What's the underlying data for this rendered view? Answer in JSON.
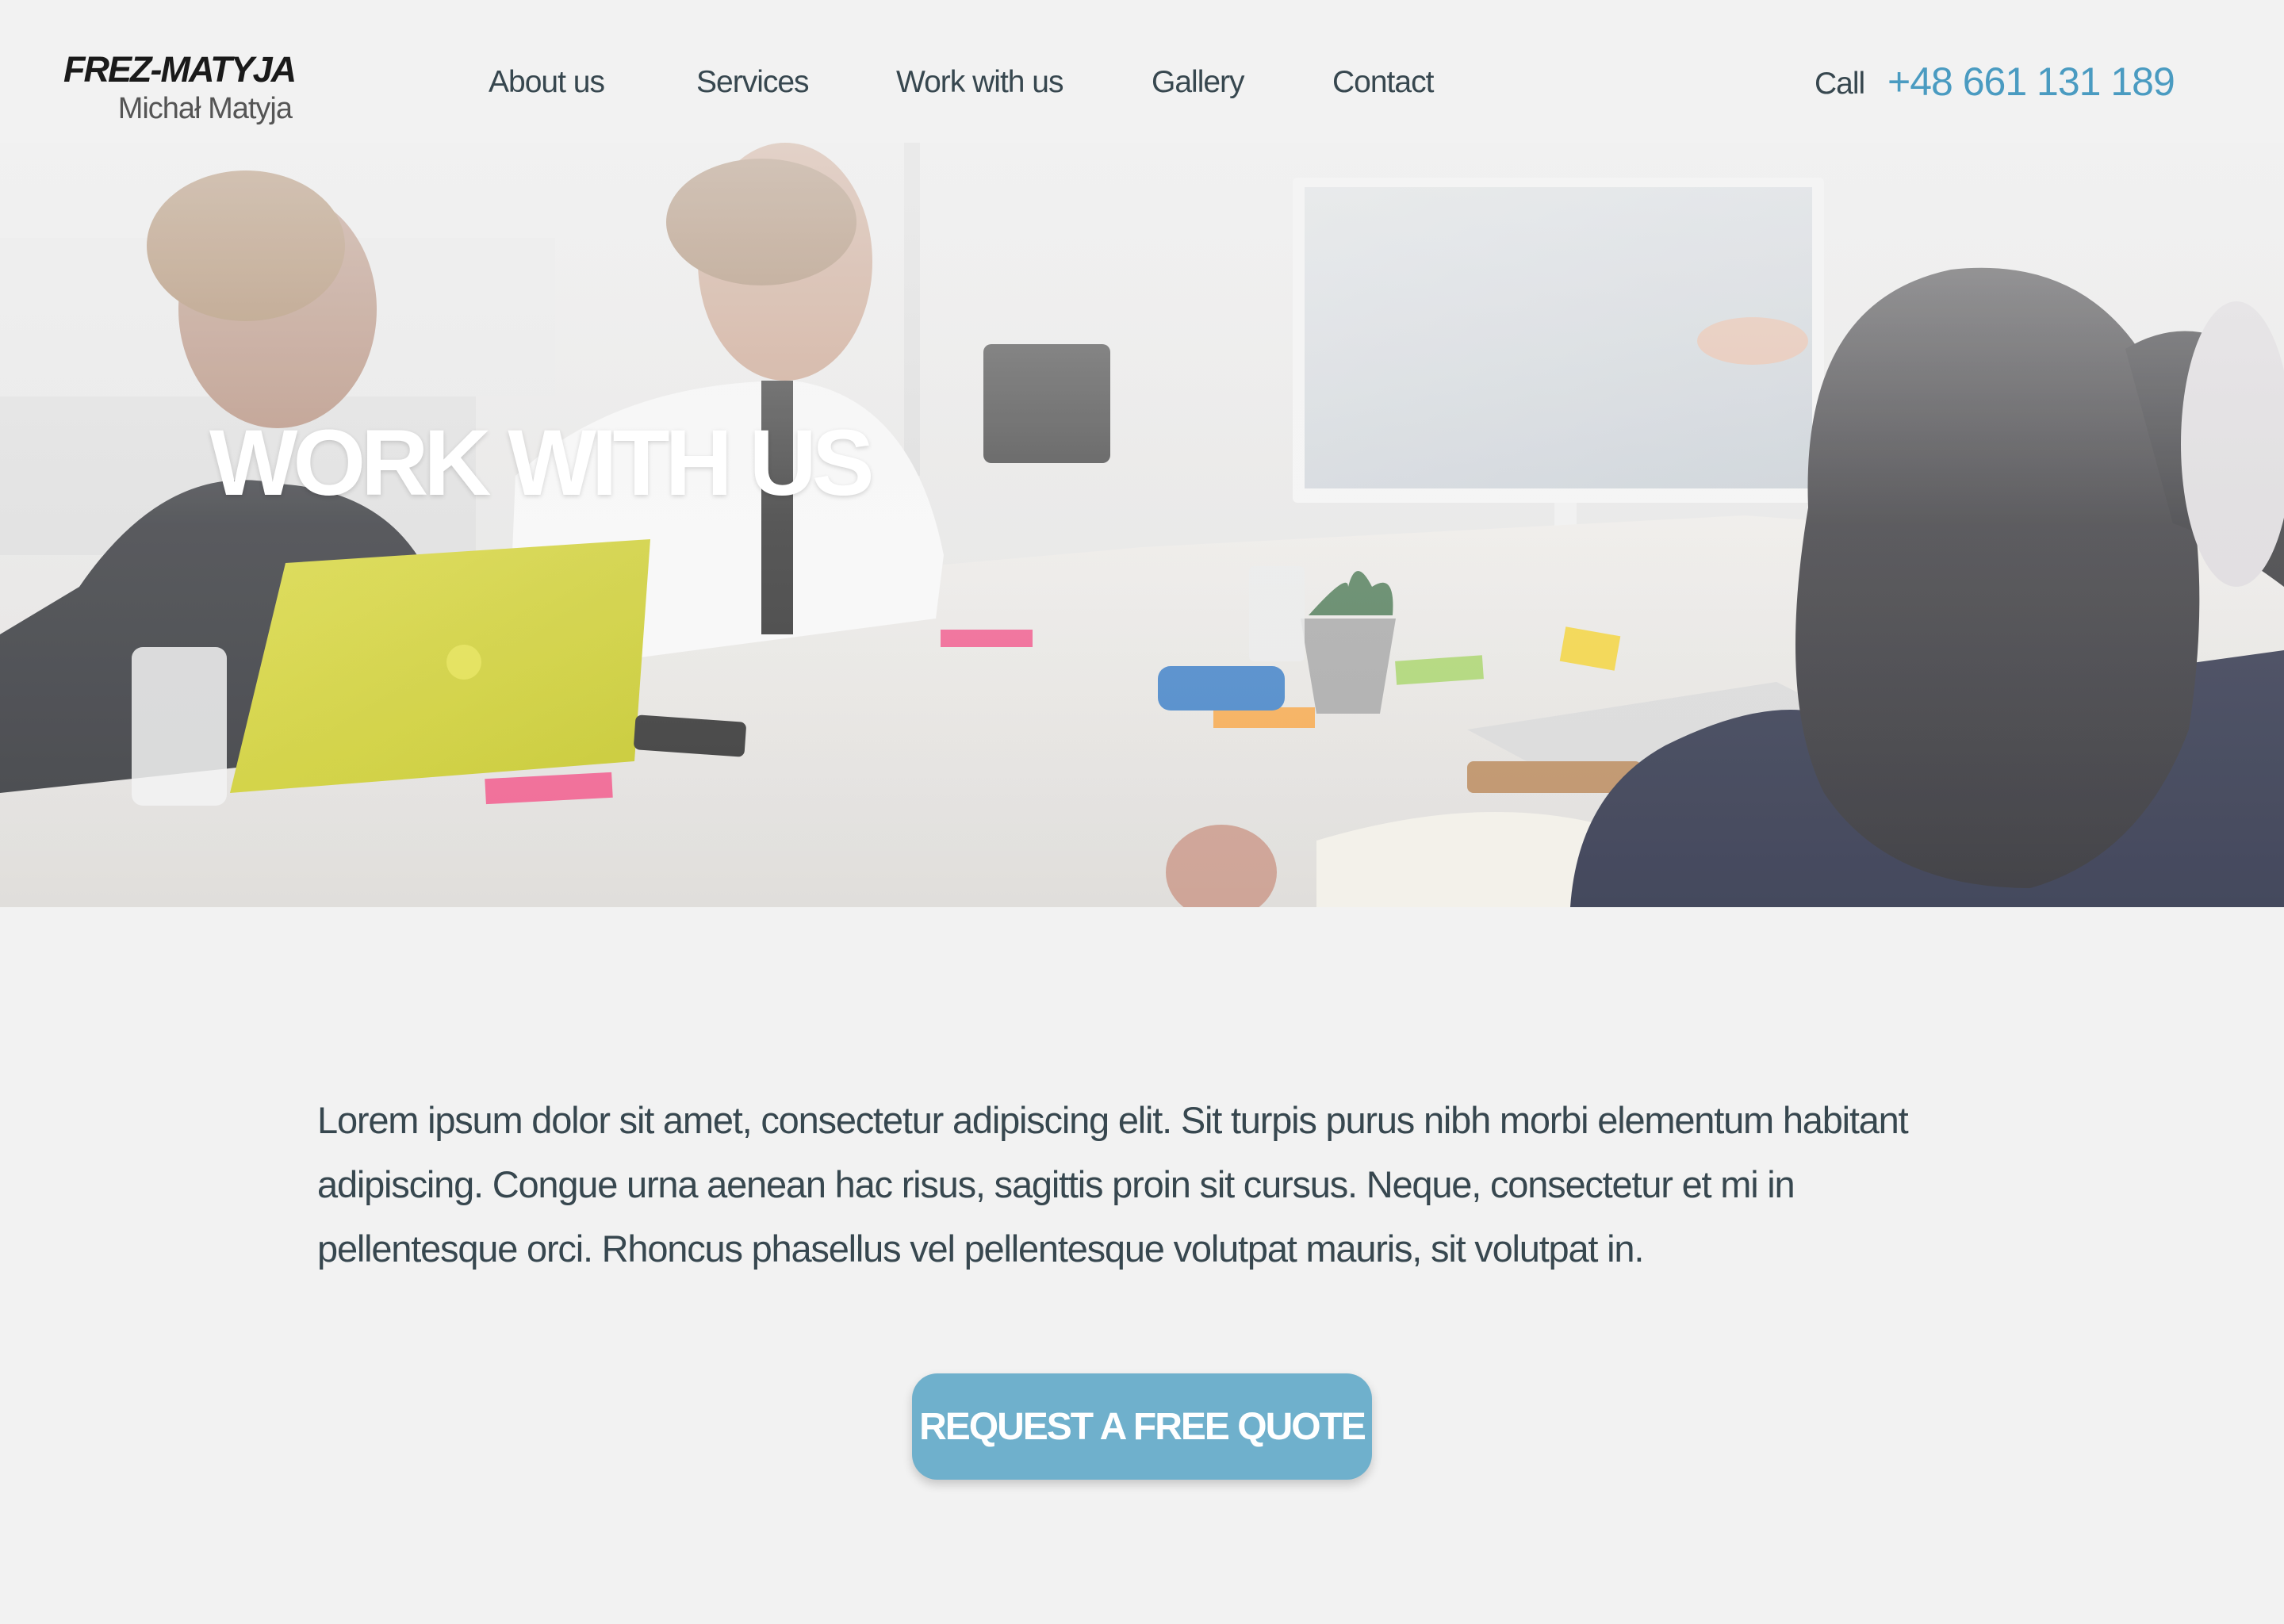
{
  "header": {
    "logo": {
      "title": "FREZ-MATYJA",
      "subtitle": "Michał Matyja"
    },
    "nav": [
      {
        "label": "About us"
      },
      {
        "label": "Services"
      },
      {
        "label": "Work with us"
      },
      {
        "label": "Gallery"
      },
      {
        "label": "Contact"
      }
    ],
    "call_label": "Call",
    "phone": "+48 661 131 189"
  },
  "hero": {
    "title": "WORK WITH US",
    "image": "office-meeting-photo"
  },
  "main": {
    "intro": "Lorem ipsum dolor sit amet, consectetur adipiscing elit. Sit turpis purus nibh morbi elementum habitant adipiscing. Congue urna aenean hac risus, sagittis proin sit cursus. Neque, consectetur et mi in pellentesque orci. Rhoncus phasellus vel pellentesque volutpat mauris, sit volutpat in.",
    "cta_label": "REQUEST A FREE QUOTE"
  },
  "colors": {
    "background": "#f2f2f2",
    "text": "#37474f",
    "accent": "#4a9bc1",
    "button": "#6fb0cc"
  }
}
